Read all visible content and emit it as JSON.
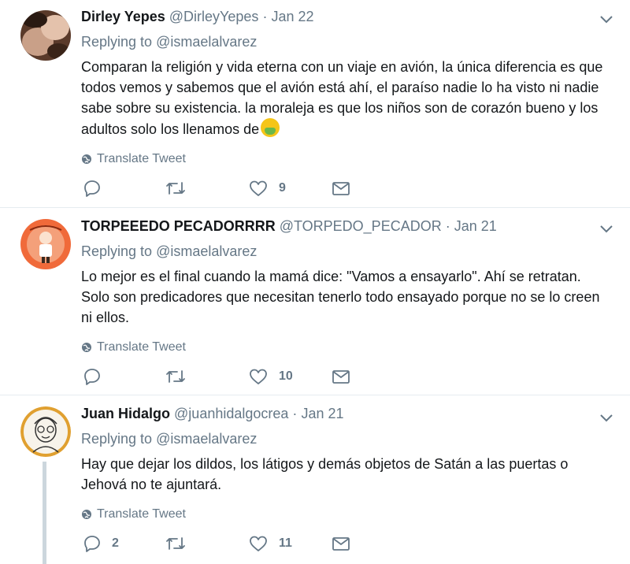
{
  "tweets": [
    {
      "fullname": "Dirley Yepes",
      "username": "@DirleyYepes",
      "time": "Jan 22",
      "reply_prefix": "Replying to",
      "reply_to": "@ismaelalvarez",
      "text": "Comparan la religión y vida eterna con un viaje en avión, la única diferencia es que todos vemos y sabemos que el avión está ahí, el paraíso nadie lo ha visto ni nadie sabe sobre su existencia. la moraleja es que los niños son de corazón bueno y los adultos solo los llenamos de",
      "emoji": "nauseated-face-emoji",
      "translate_label": "Translate Tweet",
      "replies": "",
      "retweets": "",
      "likes": "9"
    },
    {
      "fullname": "TORPEEEDO PECADORRRR",
      "username": "@TORPEDO_PECADOR",
      "time": "Jan 21",
      "reply_prefix": "Replying to",
      "reply_to": "@ismaelalvarez",
      "text": "Lo mejor es el final cuando la mamá dice: \"Vamos a ensayarlo\". Ahí se retratan. Solo son predicadores que necesitan tenerlo todo ensayado porque no se lo creen ni ellos.",
      "translate_label": "Translate Tweet",
      "replies": "",
      "retweets": "",
      "likes": "10"
    },
    {
      "fullname": "Juan Hidalgo",
      "username": "@juanhidalgocrea",
      "time": "Jan 21",
      "reply_prefix": "Replying to",
      "reply_to": "@ismaelalvarez",
      "text": "Hay que dejar los dildos, los látigos y demás objetos de Satán a las puertas o Jehová no te ajuntará.",
      "translate_label": "Translate Tweet",
      "replies": "2",
      "retweets": "",
      "likes": "11"
    }
  ],
  "separator": "·",
  "colors": {
    "text": "#14171a",
    "secondary": "#657786",
    "divider": "#e6ecf0",
    "thread_line": "#ccd6dd"
  },
  "icons": [
    "reply-icon",
    "retweet-icon",
    "like-icon",
    "dm-icon",
    "globe-icon",
    "chevron-down-icon"
  ]
}
